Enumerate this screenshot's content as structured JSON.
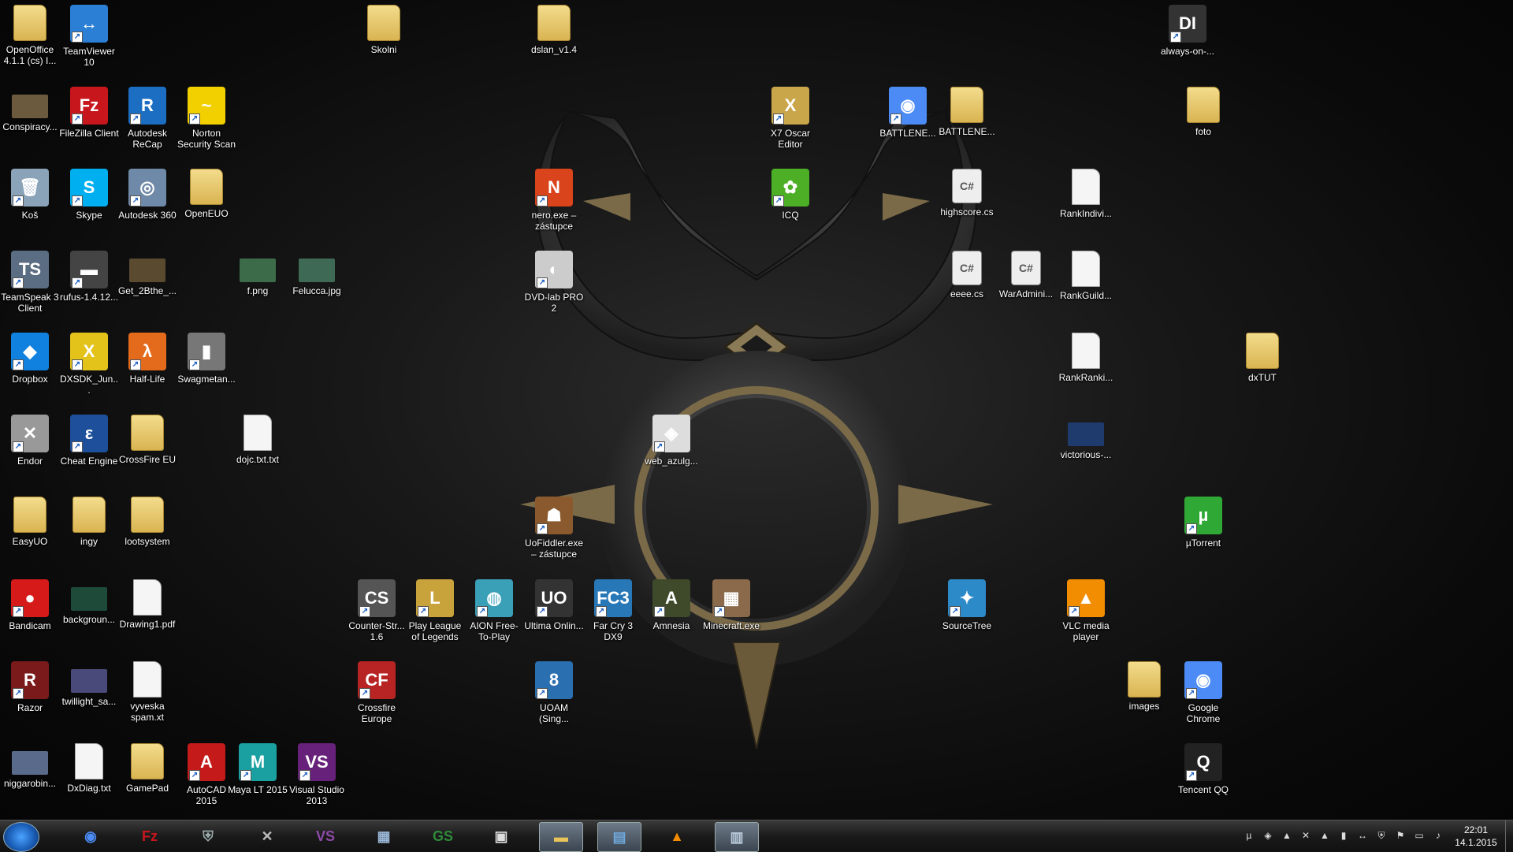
{
  "desktop_icons": [
    {
      "label": "OpenOffice 4.1.1 (cs) I...",
      "kind": "folder",
      "color": "#e7c35a",
      "glyph": ""
    },
    {
      "label": "TeamViewer 10",
      "kind": "app",
      "color": "#2b7fd4",
      "glyph": "↔"
    },
    {
      "label": "Skolni",
      "kind": "folder",
      "color": "#e7c35a",
      "glyph": ""
    },
    {
      "label": "dslan_v1.4",
      "kind": "folder",
      "color": "#e7c35a",
      "glyph": ""
    },
    {
      "label": "always-on-...",
      "kind": "app",
      "color": "#333333",
      "glyph": "DI"
    },
    {
      "label": "Conspiracy...",
      "kind": "img",
      "color": "#6b5a3e",
      "glyph": ""
    },
    {
      "label": "FileZilla Client",
      "kind": "app",
      "color": "#c8161d",
      "glyph": "Fz"
    },
    {
      "label": "Autodesk ReCap",
      "kind": "app",
      "color": "#1b6ec2",
      "glyph": "R"
    },
    {
      "label": "Norton Security Scan",
      "kind": "app",
      "color": "#f2d000",
      "glyph": "~"
    },
    {
      "label": "X7 Oscar Editor",
      "kind": "app",
      "color": "#caa64b",
      "glyph": "X"
    },
    {
      "label": "BATTLENE...",
      "kind": "app",
      "color": "#4c8bf5",
      "glyph": "◉"
    },
    {
      "label": "BATTLENE...",
      "kind": "folder",
      "color": "#e7c35a",
      "glyph": ""
    },
    {
      "label": "foto",
      "kind": "folder",
      "color": "#e7c35a",
      "glyph": ""
    },
    {
      "label": "Koš",
      "kind": "app",
      "color": "#8aa3b8",
      "glyph": "🗑"
    },
    {
      "label": "Skype",
      "kind": "app",
      "color": "#00aff0",
      "glyph": "S"
    },
    {
      "label": "Autodesk 360",
      "kind": "app",
      "color": "#6f8aa8",
      "glyph": "◎"
    },
    {
      "label": "OpenEUO",
      "kind": "folder",
      "color": "#e7c35a",
      "glyph": ""
    },
    {
      "label": "nero.exe – zástupce",
      "kind": "app",
      "color": "#d9441c",
      "glyph": "N"
    },
    {
      "label": "ICQ",
      "kind": "app",
      "color": "#4caf26",
      "glyph": "✿"
    },
    {
      "label": "highscore.cs",
      "kind": "cs",
      "color": "#e0e0e0",
      "glyph": "C#"
    },
    {
      "label": "RankIndivi...",
      "kind": "file",
      "color": "#f5f5f5",
      "glyph": ""
    },
    {
      "label": "TeamSpeak 3 Client",
      "kind": "app",
      "color": "#5b6d82",
      "glyph": "TS"
    },
    {
      "label": "rufus-1.4.12...",
      "kind": "app",
      "color": "#444444",
      "glyph": "▬"
    },
    {
      "label": "Get_2Bthe_...",
      "kind": "img",
      "color": "#5a4a30",
      "glyph": ""
    },
    {
      "label": "f.png",
      "kind": "img",
      "color": "#3c6b4a",
      "glyph": ""
    },
    {
      "label": "Felucca.jpg",
      "kind": "img",
      "color": "#3e6a55",
      "glyph": ""
    },
    {
      "label": "DVD-lab PRO 2",
      "kind": "app",
      "color": "#cccccc",
      "glyph": "◐"
    },
    {
      "label": "eeee.cs",
      "kind": "cs",
      "color": "#e0e0e0",
      "glyph": "C#"
    },
    {
      "label": "WarAdmini...",
      "kind": "cs",
      "color": "#e0e0e0",
      "glyph": "C#"
    },
    {
      "label": "RankGuild...",
      "kind": "file",
      "color": "#f5f5f5",
      "glyph": ""
    },
    {
      "label": "Dropbox",
      "kind": "app",
      "color": "#1081de",
      "glyph": "◆"
    },
    {
      "label": "DXSDK_Jun...",
      "kind": "app",
      "color": "#e3c21a",
      "glyph": "X"
    },
    {
      "label": "Half-Life",
      "kind": "app",
      "color": "#e46b1c",
      "glyph": "λ"
    },
    {
      "label": "Swagmetan...",
      "kind": "app",
      "color": "#777777",
      "glyph": "▮"
    },
    {
      "label": "RankRanki...",
      "kind": "file",
      "color": "#f5f5f5",
      "glyph": ""
    },
    {
      "label": "dxTUT",
      "kind": "folder",
      "color": "#e7c35a",
      "glyph": ""
    },
    {
      "label": "Endor",
      "kind": "app",
      "color": "#999999",
      "glyph": "✕"
    },
    {
      "label": "Cheat Engine",
      "kind": "app",
      "color": "#1d4f9a",
      "glyph": "ε"
    },
    {
      "label": "CrossFire EU",
      "kind": "folder",
      "color": "#e7c35a",
      "glyph": ""
    },
    {
      "label": "dojc.txt.txt",
      "kind": "file",
      "color": "#f5f5f5",
      "glyph": ""
    },
    {
      "label": "web_azulg...",
      "kind": "app",
      "color": "#dddddd",
      "glyph": "◈"
    },
    {
      "label": "victorious-...",
      "kind": "img",
      "color": "#1f3b6e",
      "glyph": ""
    },
    {
      "label": "EasyUO",
      "kind": "folder",
      "color": "#e7c35a",
      "glyph": ""
    },
    {
      "label": "ingy",
      "kind": "folder",
      "color": "#e7c35a",
      "glyph": ""
    },
    {
      "label": "lootsystem",
      "kind": "folder",
      "color": "#e7c35a",
      "glyph": ""
    },
    {
      "label": "UoFiddler.exe – zástupce",
      "kind": "app",
      "color": "#8a5a2e",
      "glyph": "☗"
    },
    {
      "label": "µTorrent",
      "kind": "app",
      "color": "#2fa836",
      "glyph": "µ"
    },
    {
      "label": "Bandicam",
      "kind": "app",
      "color": "#d61a1a",
      "glyph": "●"
    },
    {
      "label": "backgroun...",
      "kind": "img",
      "color": "#1e4a3a",
      "glyph": ""
    },
    {
      "label": "Drawing1.pdf",
      "kind": "file",
      "color": "#f5f5f5",
      "glyph": ""
    },
    {
      "label": "Counter-Str... 1.6",
      "kind": "app",
      "color": "#555555",
      "glyph": "CS"
    },
    {
      "label": "Play League of Legends",
      "kind": "app",
      "color": "#c8a23a",
      "glyph": "L"
    },
    {
      "label": "AION Free-To-Play",
      "kind": "app",
      "color": "#3aa0b8",
      "glyph": "◍"
    },
    {
      "label": "Ultima Onlin...",
      "kind": "app",
      "color": "#333333",
      "glyph": "UO"
    },
    {
      "label": "Far Cry 3 DX9",
      "kind": "app",
      "color": "#2878b8",
      "glyph": "FC3"
    },
    {
      "label": "Amnesia",
      "kind": "app",
      "color": "#3e4a2a",
      "glyph": "A"
    },
    {
      "label": "Minecraft.exe",
      "kind": "app",
      "color": "#8a6a4a",
      "glyph": "▦"
    },
    {
      "label": "SourceTree",
      "kind": "app",
      "color": "#2d8ac9",
      "glyph": "✦"
    },
    {
      "label": "VLC media player",
      "kind": "app",
      "color": "#f28c00",
      "glyph": "▲"
    },
    {
      "label": "Razor",
      "kind": "app",
      "color": "#7a1a1a",
      "glyph": "R"
    },
    {
      "label": "twillight_sa...",
      "kind": "img",
      "color": "#4a4a7a",
      "glyph": ""
    },
    {
      "label": "vyveska spam.xt",
      "kind": "file",
      "color": "#f5f5f5",
      "glyph": ""
    },
    {
      "label": "Crossfire Europe",
      "kind": "app",
      "color": "#b82424",
      "glyph": "CF"
    },
    {
      "label": "UOAM (Sing...",
      "kind": "app",
      "color": "#2a6fb0",
      "glyph": "8"
    },
    {
      "label": "images",
      "kind": "folder",
      "color": "#e7c35a",
      "glyph": ""
    },
    {
      "label": "Google Chrome",
      "kind": "app",
      "color": "#4c8bf5",
      "glyph": "◉"
    },
    {
      "label": "niggarobin...",
      "kind": "img",
      "color": "#5a6a8a",
      "glyph": ""
    },
    {
      "label": "DxDiag.txt",
      "kind": "file",
      "color": "#f5f5f5",
      "glyph": ""
    },
    {
      "label": "GamePad",
      "kind": "folder",
      "color": "#e7c35a",
      "glyph": ""
    },
    {
      "label": "AutoCAD 2015",
      "kind": "app",
      "color": "#c41a1a",
      "glyph": "A"
    },
    {
      "label": "Maya LT 2015",
      "kind": "app",
      "color": "#1aa0a0",
      "glyph": "M"
    },
    {
      "label": "Visual Studio 2013",
      "kind": "app",
      "color": "#68217a",
      "glyph": "VS"
    },
    {
      "label": "Tencent QQ",
      "kind": "app",
      "color": "#222222",
      "glyph": "Q"
    }
  ],
  "taskbar": {
    "start_label": "Start",
    "items": [
      {
        "name": "chrome",
        "glyph": "◉",
        "color": "#4c8bf5",
        "active": false
      },
      {
        "name": "filezilla",
        "glyph": "Fz",
        "color": "#c8161d",
        "active": false
      },
      {
        "name": "security",
        "glyph": "⛨",
        "color": "#9aa",
        "active": false
      },
      {
        "name": "endor",
        "glyph": "✕",
        "color": "#bbbbbb",
        "active": false
      },
      {
        "name": "visual-studio",
        "glyph": "VS",
        "color": "#8e4aa8",
        "active": false
      },
      {
        "name": "calculator",
        "glyph": "▦",
        "color": "#9bb8d8",
        "active": false
      },
      {
        "name": "gs",
        "glyph": "GS",
        "color": "#2e8b3a",
        "active": false
      },
      {
        "name": "window",
        "glyph": "▣",
        "color": "#dddddd",
        "active": false
      },
      {
        "name": "explorer",
        "glyph": "▬",
        "color": "#e7c35a",
        "active": true
      },
      {
        "name": "remote",
        "glyph": "▤",
        "color": "#6fa8dc",
        "active": true
      },
      {
        "name": "vlc",
        "glyph": "▲",
        "color": "#f28c00",
        "active": false
      },
      {
        "name": "notepad",
        "glyph": "▥",
        "color": "#bcd",
        "active": true
      }
    ],
    "tray_icons": [
      "utorrent-icon",
      "gamepad-icon",
      "vlc-icon",
      "endor-icon",
      "arrow-icon",
      "network-status-icon",
      "teamviewer-icon",
      "shield-icon",
      "flag-icon",
      "monitor-icon",
      "volume-icon"
    ],
    "clock_time": "22:01",
    "clock_date": "14.1.2015"
  }
}
